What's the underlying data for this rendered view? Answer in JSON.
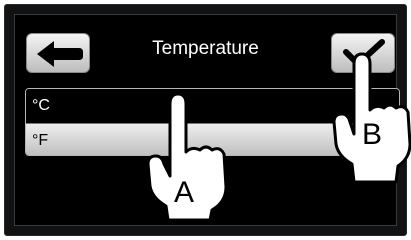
{
  "header": {
    "title": "Temperature",
    "back_icon": "arrow-left-icon",
    "confirm_icon": "checkmark-icon"
  },
  "units": {
    "options": [
      "°C",
      "°F"
    ],
    "selected": "°F"
  },
  "annotations": {
    "hand_a_label": "A",
    "hand_b_label": "B"
  },
  "colors": {
    "background": "#000000",
    "selected_row": "#d6d6d6",
    "text": "#ffffff"
  }
}
